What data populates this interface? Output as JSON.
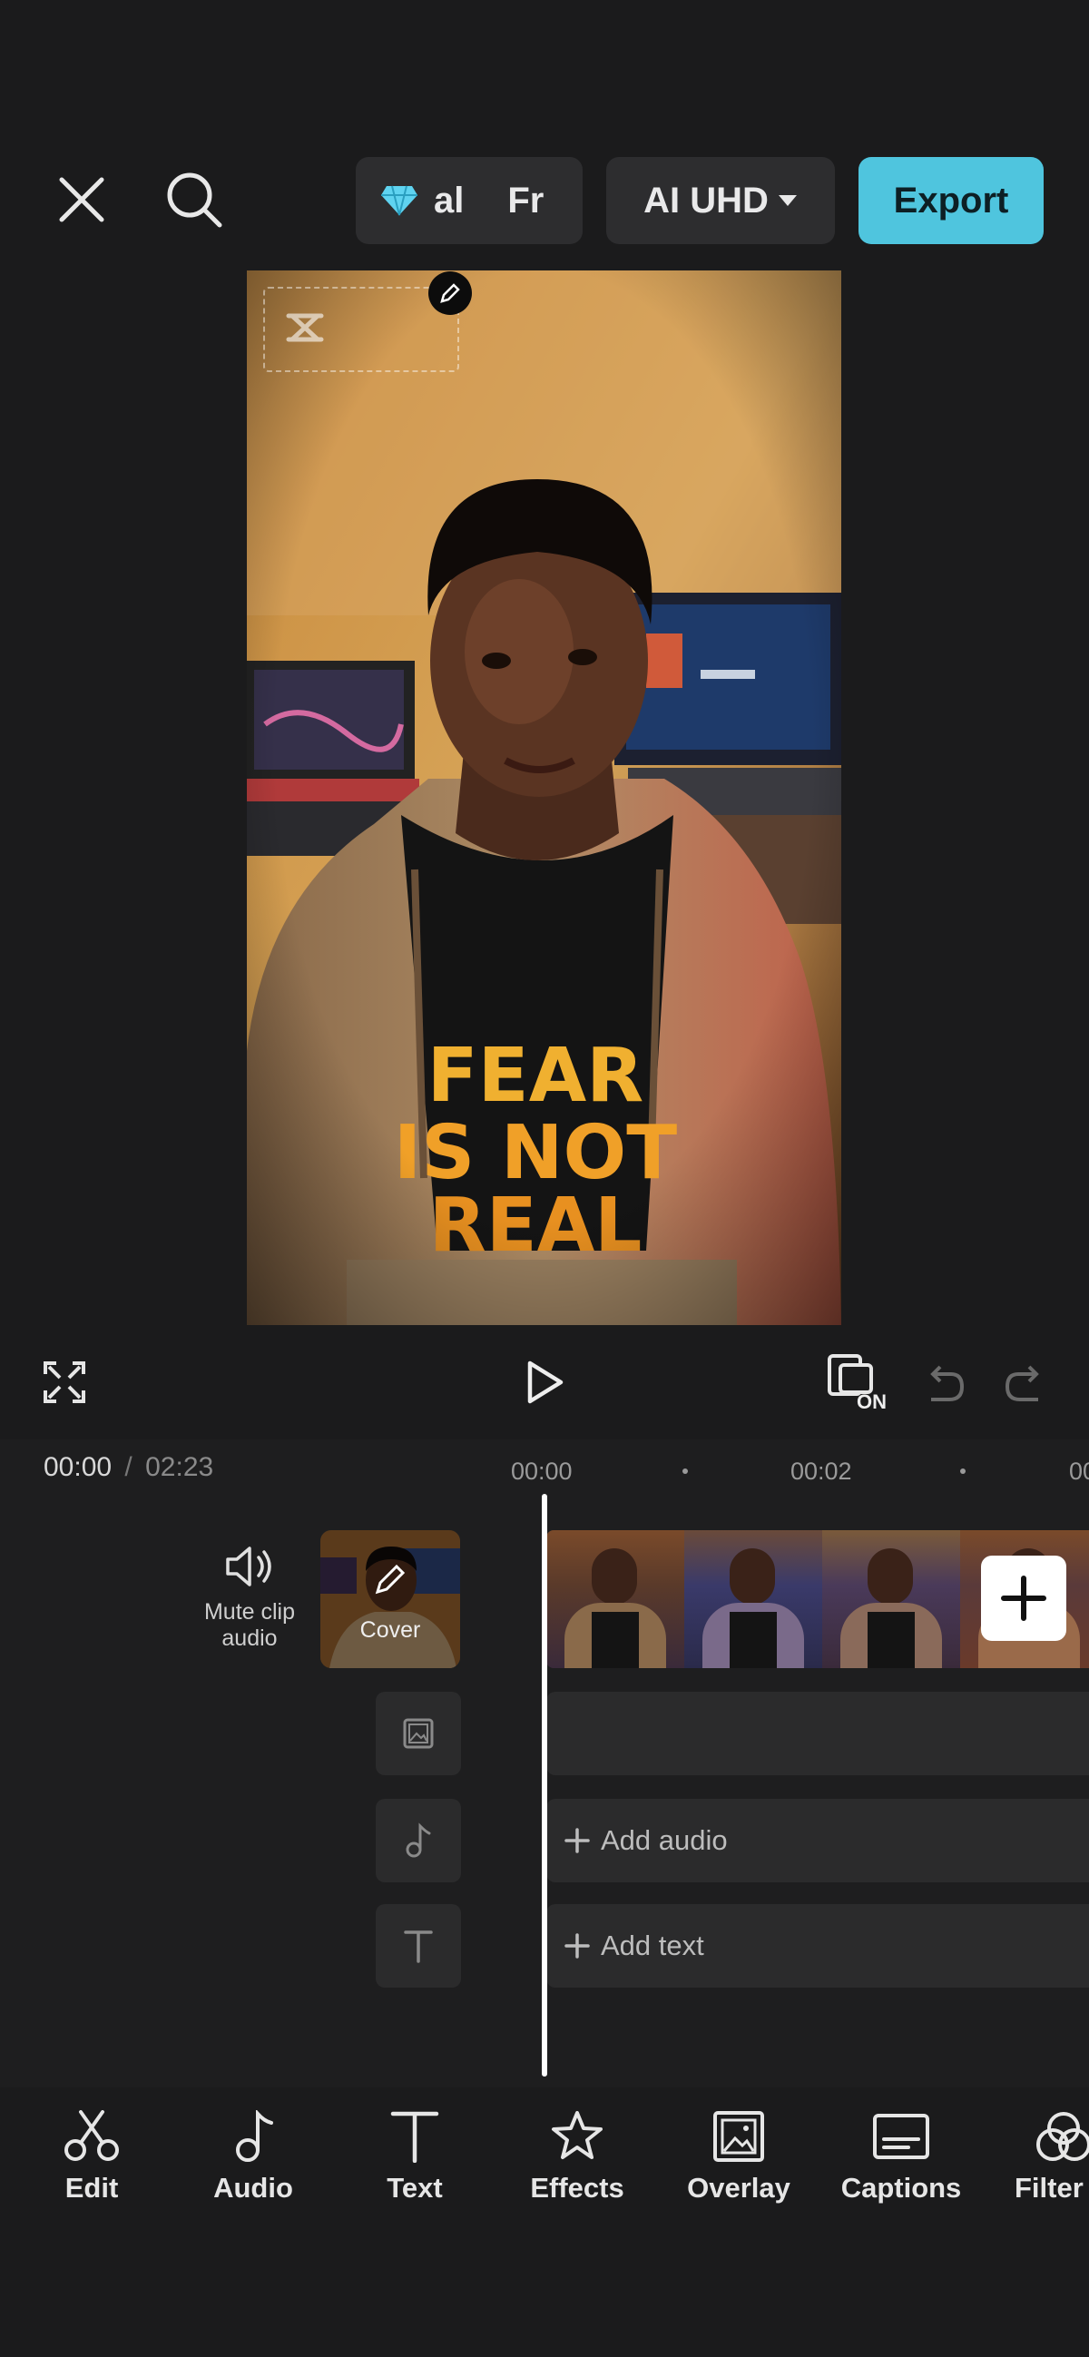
{
  "header": {
    "pro_pill_text_1": "al",
    "pro_pill_text_2": "Fr",
    "quality_label": "AI UHD",
    "export_label": "Export"
  },
  "playback": {
    "current_time": "00:00",
    "separator": "/",
    "total_time": "02:23",
    "preview_on_badge": "ON"
  },
  "ruler": {
    "ticks": [
      "00:00",
      "00:02",
      "00"
    ]
  },
  "timeline": {
    "mute_clip_audio_label_1": "Mute clip",
    "mute_clip_audio_label_2": "audio",
    "cover_label": "Cover",
    "add_audio_label": "Add audio",
    "add_text_label": "Add text"
  },
  "toolbar": {
    "items": [
      {
        "label": "Edit",
        "icon": "scissors-icon"
      },
      {
        "label": "Audio",
        "icon": "music-note-icon"
      },
      {
        "label": "Text",
        "icon": "text-icon"
      },
      {
        "label": "Effects",
        "icon": "star-icon"
      },
      {
        "label": "Overlay",
        "icon": "overlay-icon"
      },
      {
        "label": "Captions",
        "icon": "captions-icon"
      },
      {
        "label": "Filter",
        "icon": "filter-icon"
      }
    ]
  },
  "colors": {
    "background": "#1b1b1c",
    "accent": "#4fc5de",
    "pill": "#2d2d2f",
    "diamond": "#5fd3f0"
  }
}
